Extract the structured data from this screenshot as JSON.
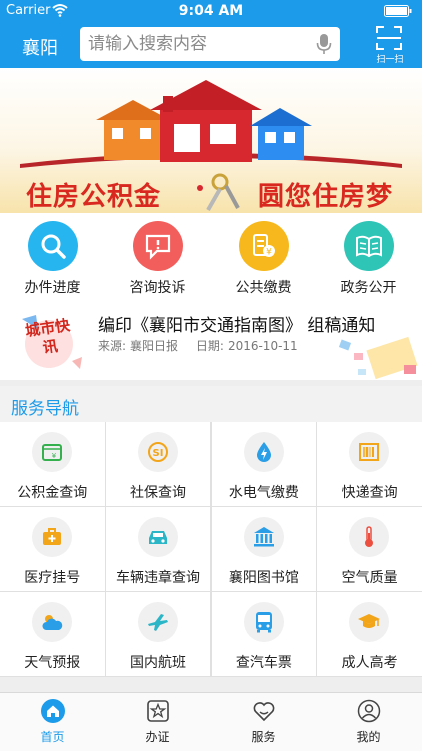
{
  "status_bar": {
    "carrier": "Carrier",
    "time": "9:04 AM"
  },
  "nav": {
    "city": "襄阳",
    "search": {
      "placeholder": "请输入搜索内容"
    },
    "scan_label": "扫一扫"
  },
  "banner": {
    "left_text": "住房公积金",
    "right_text": "圆您住房梦"
  },
  "quick_links": [
    {
      "label": "办件进度",
      "icon": "search-icon",
      "color": "#27b5ef"
    },
    {
      "label": "咨询投诉",
      "icon": "chat-alert-icon",
      "color": "#f25e5b"
    },
    {
      "label": "公共缴费",
      "icon": "coins-icon",
      "color": "#f6b81c"
    },
    {
      "label": "政务公开",
      "icon": "book-icon",
      "color": "#2ec4b6"
    }
  ],
  "news": {
    "badge": "城市快讯",
    "title": "编印《襄阳市交通指南图》 组稿通知",
    "source_label": "来源:",
    "source": "襄阳日报",
    "date_label": "日期:",
    "date": "2016-10-11"
  },
  "service": {
    "title": "服务导航",
    "items": [
      {
        "label": "公积金查询",
        "icon": "housing-fund-icon",
        "color": "#35b04e"
      },
      {
        "label": "社保查询",
        "icon": "social-security-icon",
        "color": "#f3a51a"
      },
      {
        "label": "水电气缴费",
        "icon": "utility-drop-icon",
        "color": "#2a9ee6"
      },
      {
        "label": "快递查询",
        "icon": "parcel-icon",
        "color": "#f3a51a"
      },
      {
        "label": "医疗挂号",
        "icon": "medical-kit-icon",
        "color": "#f3a51a"
      },
      {
        "label": "车辆违章查询",
        "icon": "car-icon",
        "color": "#2bb6c8"
      },
      {
        "label": "襄阳图书馆",
        "icon": "library-icon",
        "color": "#2a9ee6"
      },
      {
        "label": "空气质量",
        "icon": "thermometer-icon",
        "color": "#ec4f3f"
      },
      {
        "label": "天气预报",
        "icon": "weather-icon",
        "color": "#2a9ee6"
      },
      {
        "label": "国内航班",
        "icon": "airplane-icon",
        "color": "#2bb6c8"
      },
      {
        "label": "查汽车票",
        "icon": "bus-icon",
        "color": "#2a9ee6"
      },
      {
        "label": "成人高考",
        "icon": "graduation-cap-icon",
        "color": "#f3a51a"
      }
    ]
  },
  "tabs": [
    {
      "label": "首页",
      "icon": "home-icon",
      "active": true
    },
    {
      "label": "办证",
      "icon": "star-box-icon",
      "active": false
    },
    {
      "label": "服务",
      "icon": "heart-icon",
      "active": false
    },
    {
      "label": "我的",
      "icon": "user-icon",
      "active": false
    }
  ],
  "colors": {
    "primary": "#1b9bea",
    "banner_text": "#d8281f"
  }
}
